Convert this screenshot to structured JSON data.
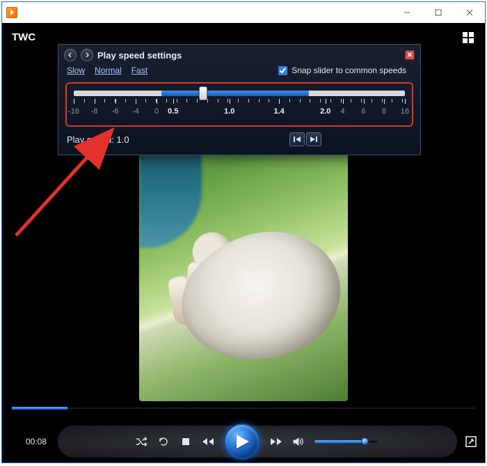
{
  "window": {
    "title": ""
  },
  "overlay": {
    "left_text": "TWC"
  },
  "panel": {
    "title": "Play speed settings",
    "links": {
      "slow": "Slow",
      "normal": "Normal",
      "fast": "Fast"
    },
    "snap_label": "Snap slider to common speeds",
    "snap_checked": true,
    "slider": {
      "fill_start_pct": 26.5,
      "fill_end_pct": 71,
      "thumb_pct": 39,
      "ticks": [
        {
          "pos": 0,
          "label": "-16",
          "bright": false,
          "major": true
        },
        {
          "pos": 6.2,
          "label": "-8",
          "bright": false,
          "major": true
        },
        {
          "pos": 12.5,
          "label": "-6",
          "bright": false,
          "major": true
        },
        {
          "pos": 18.7,
          "label": "-4",
          "bright": false,
          "major": true
        },
        {
          "pos": 25,
          "label": "0",
          "bright": false,
          "major": true
        },
        {
          "pos": 30,
          "label": "0.5",
          "bright": true,
          "major": true
        },
        {
          "pos": 47,
          "label": "1.0",
          "bright": true,
          "major": true
        },
        {
          "pos": 62,
          "label": "1.4",
          "bright": true,
          "major": true
        },
        {
          "pos": 76,
          "label": "2.0",
          "bright": true,
          "major": true
        },
        {
          "pos": 81.2,
          "label": "4",
          "bright": false,
          "major": true
        },
        {
          "pos": 87.5,
          "label": "6",
          "bright": false,
          "major": true
        },
        {
          "pos": 93.7,
          "label": "8",
          "bright": false,
          "major": true
        },
        {
          "pos": 100,
          "label": "16",
          "bright": false,
          "major": true
        }
      ],
      "minor_every_pct": 3.1
    },
    "play_speed_label": "Play speed: 1.0"
  },
  "playback": {
    "current_time": "00:08",
    "seek_fill_pct": 12,
    "volume_pct": 80
  }
}
